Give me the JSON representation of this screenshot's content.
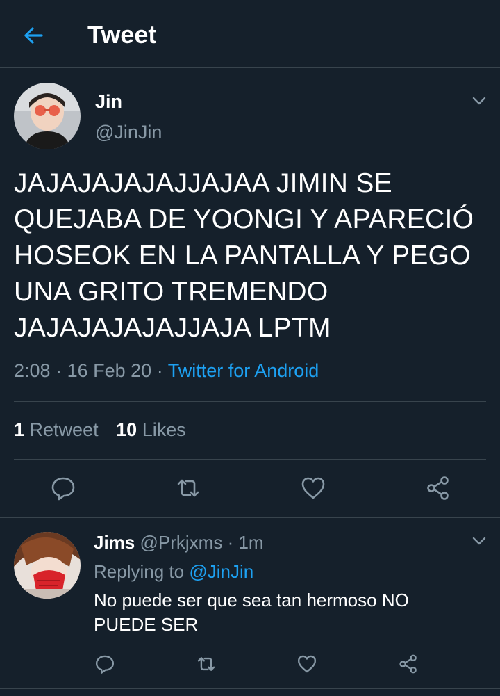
{
  "header": {
    "title": "Tweet",
    "back_icon": "back-arrow-icon"
  },
  "colors": {
    "background": "#15202b",
    "accent": "#1da1f2",
    "muted": "#8899a6",
    "divider": "#38444d"
  },
  "tweet": {
    "author_name": "Jin",
    "author_handle": "@JinJin",
    "text": "JAJAJAJAJAJJAJAA JIMIN SE QUEJABA DE YOONGI Y APARECIÓ HOSEOK EN LA PANTALLA Y PEGO UNA GRITO TREMENDO JAJAJAJAJAJJAJA LPTM",
    "time": "2:08",
    "date": "16 Feb 20",
    "separator": "·",
    "source": "Twitter for Android",
    "retweet_count": "1",
    "retweet_label": "Retweet",
    "like_count": "10",
    "like_label": "Likes"
  },
  "reply": {
    "author_name": "Jims",
    "author_handle": "@Prkjxms",
    "separator": "·",
    "time": "1m",
    "replying_prefix": "Replying to",
    "replying_to": "@JinJin",
    "text": "No puede ser que sea tan hermoso NO PUEDE SER"
  }
}
